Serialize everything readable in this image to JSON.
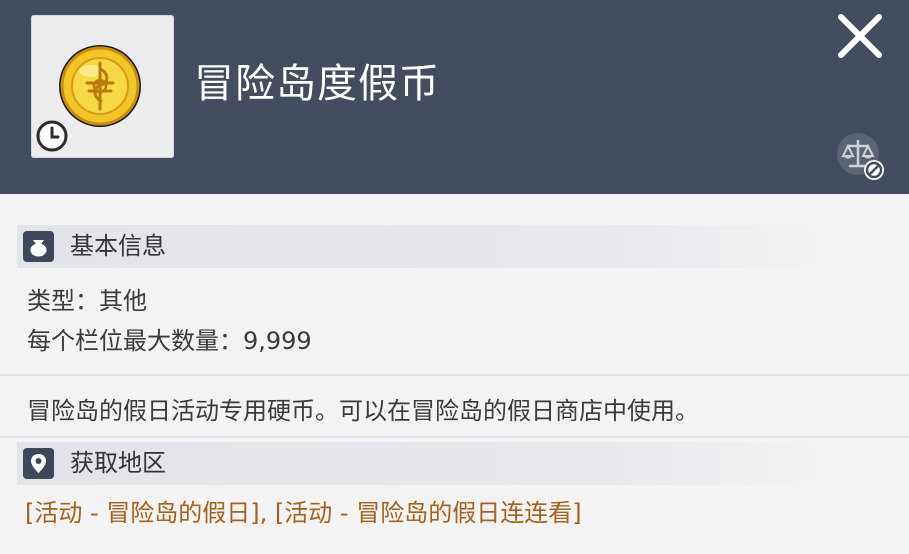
{
  "item": {
    "name": "冒险岛度假币",
    "icon": "gold-coin-icon",
    "timer_icon": "clock-icon"
  },
  "header": {
    "close_icon": "close-icon",
    "trade_icon": "untradeable-scale-icon",
    "background_color": "#434c60"
  },
  "basic_info": {
    "title": "基本信息",
    "icon": "bag-icon",
    "type_line": "类型：其他",
    "max_stack_line": "每个栏位最大数量：9,999"
  },
  "description": "冒险岛的假日活动专用硬币。可以在冒险岛的假日商店中使用。",
  "obtain_region": {
    "title": "获取地区",
    "icon": "location-pin-icon",
    "link_1": "[活动 - 冒险岛的假日]",
    "separator": ", ",
    "link_2": "[活动 - 冒险岛的假日连连看]",
    "link_color": "#a4621e"
  }
}
